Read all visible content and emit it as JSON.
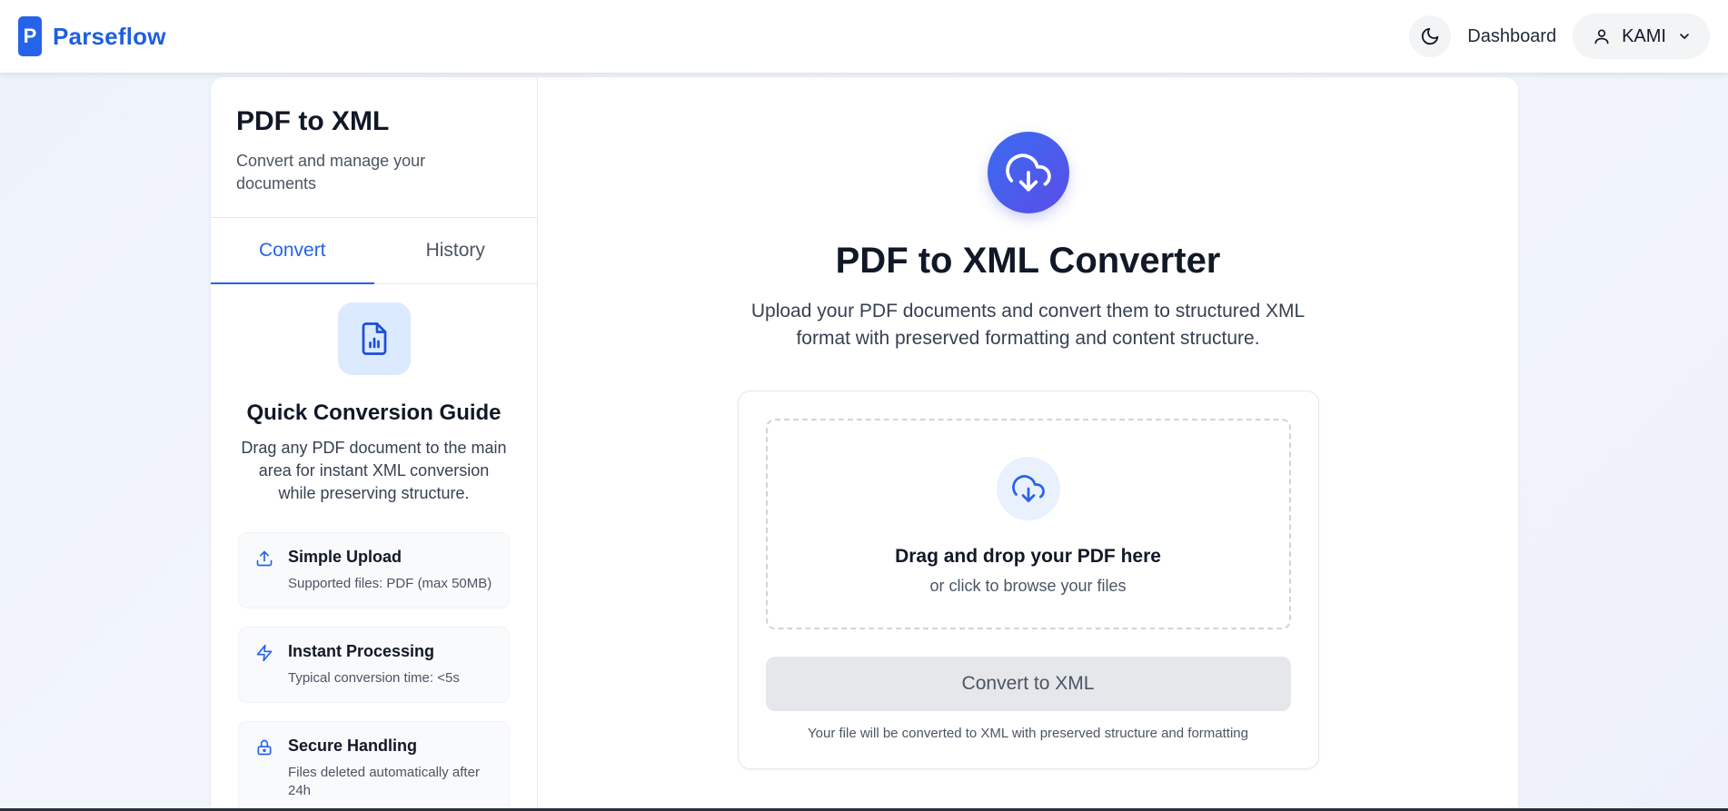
{
  "navbar": {
    "logo_letter": "P",
    "brand": "Parseflow",
    "theme_icon": "moon-icon",
    "dashboard_label": "Dashboard",
    "user_name": "KAMI",
    "user_icon": "user-icon",
    "chevron_icon": "chevron-down-icon"
  },
  "sidebar": {
    "title": "PDF to XML",
    "subtitle": "Convert and manage your documents",
    "tabs": [
      {
        "label": "Convert",
        "active": true
      },
      {
        "label": "History",
        "active": false
      }
    ],
    "guide": {
      "icon": "file-chart-icon",
      "title": "Quick Conversion Guide",
      "description": "Drag any PDF document to the main area for instant XML conversion while preserving structure."
    },
    "features": [
      {
        "icon": "upload-icon",
        "title": "Simple Upload",
        "description": "Supported files: PDF (max 50MB)"
      },
      {
        "icon": "lightning-icon",
        "title": "Instant Processing",
        "description": "Typical conversion time: <5s"
      },
      {
        "icon": "lock-icon",
        "title": "Secure Handling",
        "description": "Files deleted automatically after 24h"
      }
    ]
  },
  "main": {
    "hero_icon": "cloud-download-icon",
    "title": "PDF to XML Converter",
    "description": "Upload your PDF documents and convert them to structured XML format with preserved formatting and content structure.",
    "dropzone": {
      "icon": "cloud-download-icon",
      "title": "Drag and drop your PDF here",
      "subtitle": "or click to browse your files"
    },
    "convert_button": "Convert to XML",
    "note": "Your file will be converted to XML with preserved structure and formatting"
  },
  "colors": {
    "brand": "#2563eb",
    "page_background": "#eef2fb",
    "button_disabled": "#e5e7eb"
  }
}
